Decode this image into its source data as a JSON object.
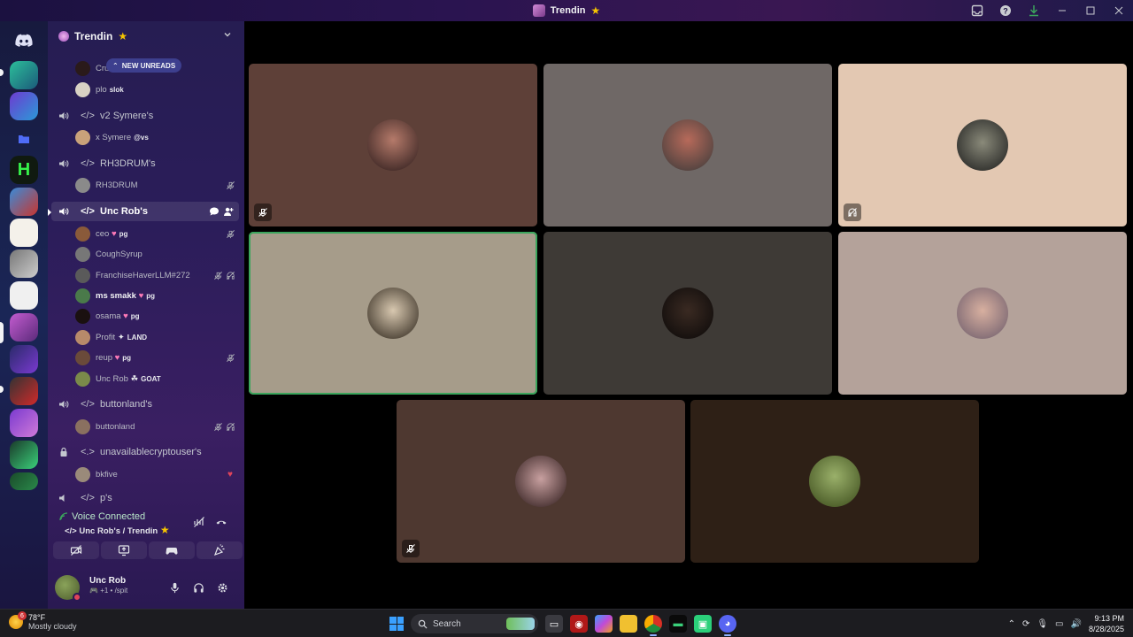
{
  "window": {
    "title": "Trendin"
  },
  "server": {
    "name": "Trendin",
    "collapse_icon": "chevron-down-icon"
  },
  "new_unreads": "NEW UNREADS",
  "sidebar": {
    "partial_user": {
      "name": "Cru"
    },
    "users_top": [
      {
        "name": "plo",
        "tag": "slok"
      }
    ],
    "channels": [
      {
        "name": "v2 Symere's",
        "users": [
          {
            "name": "x Symere",
            "tag": "@vs"
          }
        ]
      },
      {
        "name": "RH3DRUM's",
        "users": [
          {
            "name": "RH3DRUM",
            "tag": ""
          }
        ]
      },
      {
        "name": "Unc Rob's",
        "active": true,
        "users": [
          {
            "name": "ceo",
            "tag": "pg"
          },
          {
            "name": "CoughSyrup",
            "tag": ""
          },
          {
            "name": "FranchiseHaverLLM#272",
            "tag": ""
          },
          {
            "name": "ms smakk",
            "tag": "pg"
          },
          {
            "name": "osama",
            "tag": "pg"
          },
          {
            "name": "Profit",
            "tag": "LAND"
          },
          {
            "name": "reup",
            "tag": "pg"
          },
          {
            "name": "Unc Rob",
            "tag": "GOAT"
          }
        ]
      },
      {
        "name": "buttonland's",
        "users": [
          {
            "name": "buttonland",
            "tag": ""
          }
        ]
      },
      {
        "name": "unavailablecryptouser's",
        "users": [
          {
            "name": "bkfive",
            "tag": ""
          }
        ]
      },
      {
        "name": "p's",
        "users": []
      }
    ]
  },
  "voice": {
    "status": "Voice Connected",
    "location": "Unc Rob's / Trendin"
  },
  "me": {
    "name": "Unc Rob",
    "status": "/spit"
  },
  "taskbar": {
    "temperature": "78°F",
    "weather": "Mostly cloudy",
    "weather_badge": "6",
    "search_placeholder": "Search",
    "time": "9:13 PM",
    "date": "8/28/2025"
  },
  "colors": {
    "speaking": "#3ba55c",
    "accent": "#5865f2"
  }
}
